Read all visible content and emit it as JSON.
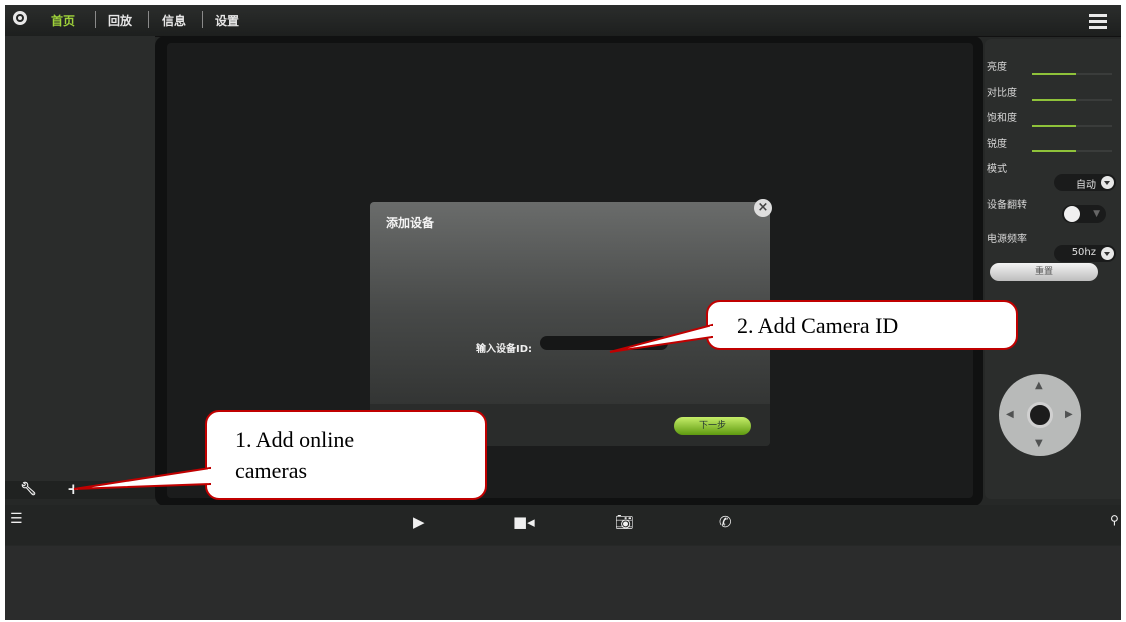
{
  "nav": {
    "items": [
      "首页",
      "回放",
      "信息",
      "设置"
    ],
    "active_index": 0,
    "accent": "#9fd23a"
  },
  "right_panel": {
    "brightness_label": "亮度",
    "contrast_label": "对比度",
    "saturation_label": "饱和度",
    "sharpness_label": "锐度",
    "mode_label": "模式",
    "mode_value": "自动",
    "flip_label": "设备翻转",
    "power_freq_label": "电源频率",
    "power_freq_value": "50hz",
    "reset_label": "重置",
    "slider_levels": [
      0.55,
      0.55,
      0.55,
      0.55
    ]
  },
  "dialog": {
    "title": "添加设备",
    "input_label": "输入设备ID:",
    "input_value": "",
    "next_label": "下一步"
  },
  "callouts": {
    "add_online": "1. Add online cameras",
    "add_online_line1": "1. Add online",
    "add_online_line2": "cameras",
    "add_id": "2. Add Camera ID"
  },
  "icons": [
    "logo-icon",
    "menu-icon",
    "wrench-icon",
    "plus-icon",
    "list-icon",
    "play-icon",
    "record-icon",
    "camera-icon",
    "phone-icon",
    "location-icon",
    "close-icon"
  ]
}
